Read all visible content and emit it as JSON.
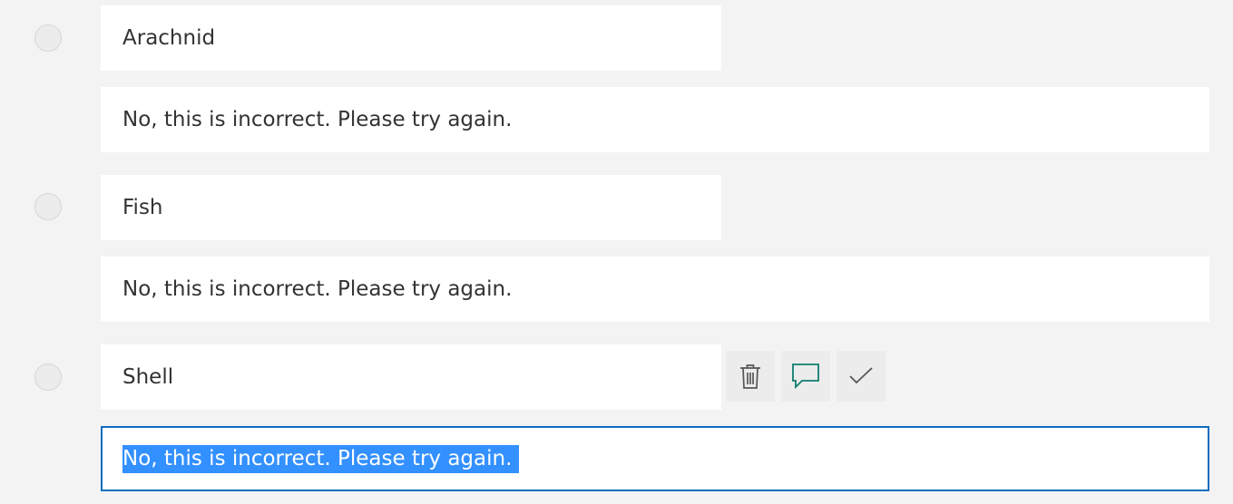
{
  "question": {
    "options": [
      {
        "label": "Arachnid",
        "feedback": "No, this is incorrect. Please try again."
      },
      {
        "label": "Fish",
        "feedback": "No, this is incorrect. Please try again."
      },
      {
        "label": "Shell",
        "feedback": "No, this is incorrect. Please try again.",
        "feedback_selected": true,
        "actions": [
          {
            "icon": "trash-icon",
            "label": "Delete option"
          },
          {
            "icon": "comment-icon",
            "label": "Add feedback"
          },
          {
            "icon": "checkmark-icon",
            "label": "Correct answer"
          }
        ]
      }
    ]
  },
  "colors": {
    "page_background": "#f3f3f3",
    "field_background": "#ffffff",
    "focus_border": "#106ebe",
    "selection_highlight": "#3390ff",
    "feedback_icon": "#0f7d6f"
  }
}
